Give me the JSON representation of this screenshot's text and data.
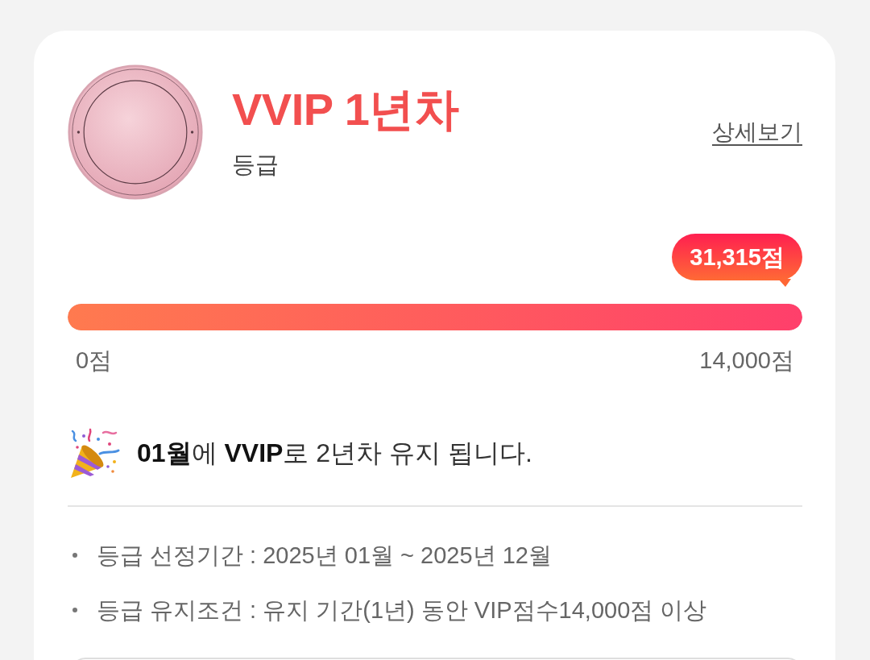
{
  "grade": {
    "title": "VVIP 1년차",
    "subtitle": "등급",
    "detail_link": "상세보기"
  },
  "progress": {
    "score": "31,315점",
    "level": 1,
    "min_label": "0점",
    "max_label": "14,000점"
  },
  "notice": "**01월**에 **VVIP**로 2년차 유지 됩니다.",
  "details": [
    "등급 선정기간 : 2025년 01월 ~ 2025년 12월",
    "등급 유지조건 : 유지 기간(1년) 동안 VIP점수14,000점 이상"
  ]
}
